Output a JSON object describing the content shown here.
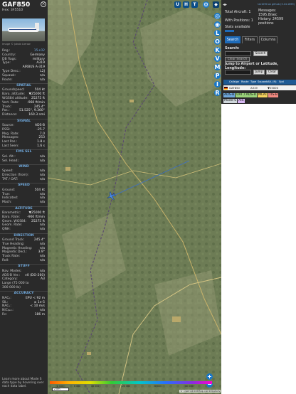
{
  "aircraft": {
    "callsign": "GAF850",
    "hex_line": "Hex: 3F5510",
    "photo_credit": "Image © Jakob Lierow"
  },
  "info": {
    "rows_top": [
      {
        "k": "Reg.:",
        "v": "15+02",
        "link": true
      },
      {
        "k": "Country:",
        "v": "Germany"
      },
      {
        "k": "DB flags:",
        "v": "military"
      },
      {
        "k": "Type:",
        "v": "A319"
      },
      {
        "k": "",
        "v": "AIRBUS A-319"
      },
      {
        "k": "Type Desc.:",
        "v": "L2J"
      },
      {
        "k": "Squawk:",
        "v": "n/a"
      },
      {
        "k": "Route:",
        "v": "n/a"
      }
    ],
    "spatial_title": "SPATIAL",
    "spatial": [
      {
        "k": "Groundspeed:",
        "v": "504 kt"
      },
      {
        "k": "Baro. altitude:",
        "v": "▼25000 ft"
      },
      {
        "k": "WGS84 altitude:",
        "v": "25275 ft"
      },
      {
        "k": "Vert. Rate:",
        "v": "-960 ft/min"
      },
      {
        "k": "Track:",
        "v": "245.4°"
      },
      {
        "k": "Pos.:",
        "v": "51.525°, 9.360°"
      },
      {
        "k": "Distance:",
        "v": "160.3 nmi"
      }
    ],
    "signal_title": "SIGNAL",
    "signal": [
      {
        "k": "Source:",
        "v": "ADS-B"
      },
      {
        "k": "RSSI:",
        "v": "-25.7"
      },
      {
        "k": "Msg. Rate:",
        "v": "7.0"
      },
      {
        "k": "Messages:",
        "v": "253"
      },
      {
        "k": "Last Pos.:",
        "v": "1.8 s"
      },
      {
        "k": "Last Seen:",
        "v": "1.6 s"
      }
    ],
    "fms_title": "FMS SEL",
    "fms": [
      {
        "k": "Sel. Alt.:",
        "v": "n/a"
      },
      {
        "k": "Sel. Head.:",
        "v": "n/a"
      }
    ],
    "wind_title": "WIND",
    "wind": [
      {
        "k": "Speed:",
        "v": "n/a"
      },
      {
        "k": "Direction (from):",
        "v": "n/a"
      },
      {
        "k": "TAT / OAT:",
        "v": "n/a"
      }
    ],
    "speed_title": "SPEED",
    "speed": [
      {
        "k": "Ground:",
        "v": "504 kt"
      },
      {
        "k": "True:",
        "v": "n/a"
      },
      {
        "k": "Indicated:",
        "v": "n/a"
      },
      {
        "k": "Mach:",
        "v": "n/a"
      }
    ],
    "altitude_title": "ALTITUDE",
    "altitude": [
      {
        "k": "Barometric:",
        "v": "▼25000 ft"
      },
      {
        "k": "Baro. Rate:",
        "v": "-960 ft/min"
      },
      {
        "k": "Geom. WGS84:",
        "v": "25275 ft"
      },
      {
        "k": "Geom. Rate:",
        "v": "n/a"
      },
      {
        "k": "QNH:",
        "v": "n/a"
      }
    ],
    "direction_title": "DIRECTION",
    "direction": [
      {
        "k": "Ground Track:",
        "v": "245.4°"
      },
      {
        "k": "True Heading:",
        "v": "n/a"
      },
      {
        "k": "Magnetic Heading:",
        "v": "n/a"
      },
      {
        "k": "Magnetic Decl.:",
        "v": "3.9°"
      },
      {
        "k": "Track Rate:",
        "v": "n/a"
      },
      {
        "k": "Roll:",
        "v": "n/a"
      }
    ],
    "stuff_title": "STUFF",
    "stuff": [
      {
        "k": "Nav. Modes:",
        "v": "n/a"
      },
      {
        "k": "ADS-B Ver.:",
        "v": "v0 (DO-260)"
      },
      {
        "k": "Category:",
        "v": "A3"
      },
      {
        "k": "Large (75 000 to",
        "v": ""
      },
      {
        "k": "300 000 lb)",
        "v": ""
      }
    ],
    "accuracy_title": "ACCURACY",
    "accuracy": [
      {
        "k": "NACₚ:",
        "v": "EPU < 92 m"
      },
      {
        "k": "SIL:",
        "v": "≤ 1e-5"
      },
      {
        "k": "NACᵥ:",
        "v": "< 10 m/s"
      },
      {
        "k": "NICᵦₐᵣₒ:",
        "v": "n/a"
      },
      {
        "k": "Rc:",
        "v": "186 m"
      }
    ],
    "footnote": "Learn more about Mode S data type by hovering over each data label."
  },
  "map": {
    "top_buttons": [
      "U",
      "H",
      "T"
    ],
    "side_buttons": [
      "L",
      "O",
      "K",
      "V",
      "M",
      "P",
      "I",
      "R"
    ],
    "zoom_in": "+",
    "zoom_out": "−",
    "scale_labels": [
      "2 000",
      "6 000",
      "10 000",
      "20 000",
      "30 000",
      "40 000+"
    ],
    "km_label": "2 km",
    "osm": "© OpenStreetMap contributors",
    "colors": {
      "track": "#3b6fc9",
      "plane": "#4a8be8"
    }
  },
  "right": {
    "nav_arrows": "◂▸",
    "version": "tar1090 on github (3.14.1659)",
    "total_aircraft": "Total Aircraft: 1",
    "with_positions": "With Positions: 1",
    "stats": "Stats available",
    "messages": "Messages: 1595.8/sec",
    "history": "History: 24599 positions",
    "tabs": [
      "Search",
      "Filters",
      "Columns"
    ],
    "search_label": "Search:",
    "search_button": "Search",
    "clear_search": "Clear Search",
    "jump_label": "Jump to Airport or Latitude, Longitude:",
    "jump_button": "Jump",
    "clear_button": "Clear",
    "table_headers": [
      "Callsign",
      "Route",
      "Type",
      "Squawk",
      "Alt. (ft)",
      "Spd"
    ],
    "table_row": [
      "GAF850",
      "",
      "A319",
      "",
      "▼25000",
      ""
    ],
    "legend": [
      {
        "label": "ADS-B",
        "color": "#6fa8dc"
      },
      {
        "label": "UAT / ADS-R",
        "color": "#9ad27a"
      },
      {
        "label": "MLAT",
        "color": "#f4d35e"
      },
      {
        "label": "TIS-B",
        "color": "#f28b82"
      },
      {
        "label": "Mode-S",
        "color": "#cfd8dc"
      },
      {
        "label": "AIS",
        "color": "#d7b8f3"
      }
    ]
  }
}
